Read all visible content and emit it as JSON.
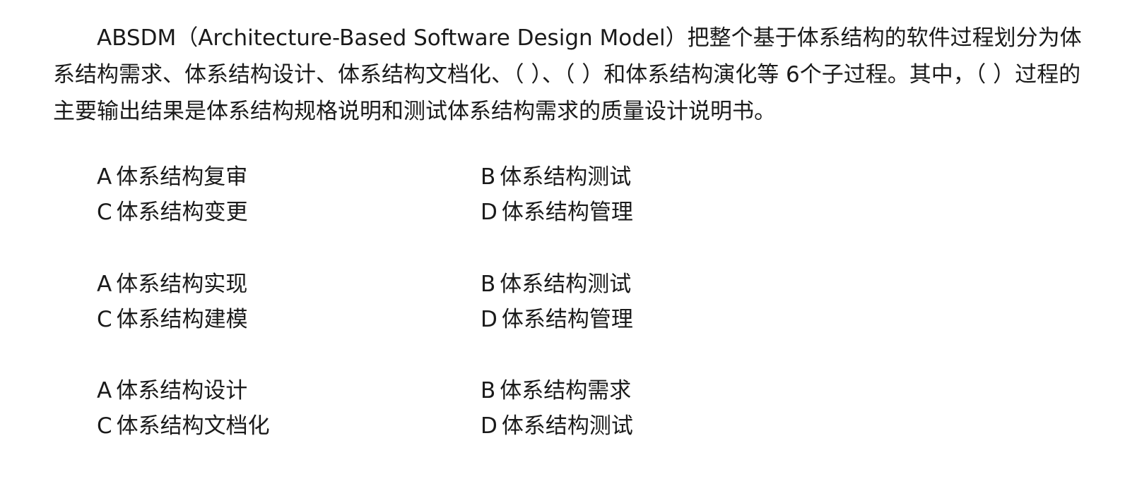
{
  "question": {
    "text": "ABSDM（Architecture-Based Software Design Model）把整个基于体系结构的软件过程划分为体系结构需求、体系结构设计、体系结构文档化、（ ）、（ ）和体系结构演化等 6个子过程。其中，（ ）过程的主要输出结果是体系结构规格说明和测试体系结构需求的质量设计说明书。"
  },
  "option_groups": [
    {
      "A": {
        "letter": "A",
        "text": "体系结构复审"
      },
      "B": {
        "letter": "B",
        "text": "体系结构测试"
      },
      "C": {
        "letter": "C",
        "text": "体系结构变更"
      },
      "D": {
        "letter": "D",
        "text": "体系结构管理"
      }
    },
    {
      "A": {
        "letter": "A",
        "text": "体系结构实现"
      },
      "B": {
        "letter": "B",
        "text": "体系结构测试"
      },
      "C": {
        "letter": "C",
        "text": "体系结构建模"
      },
      "D": {
        "letter": "D",
        "text": "体系结构管理"
      }
    },
    {
      "A": {
        "letter": "A",
        "text": "体系结构设计"
      },
      "B": {
        "letter": "B",
        "text": "体系结构需求"
      },
      "C": {
        "letter": "C",
        "text": "体系结构文档化"
      },
      "D": {
        "letter": "D",
        "text": "体系结构测试"
      }
    }
  ]
}
